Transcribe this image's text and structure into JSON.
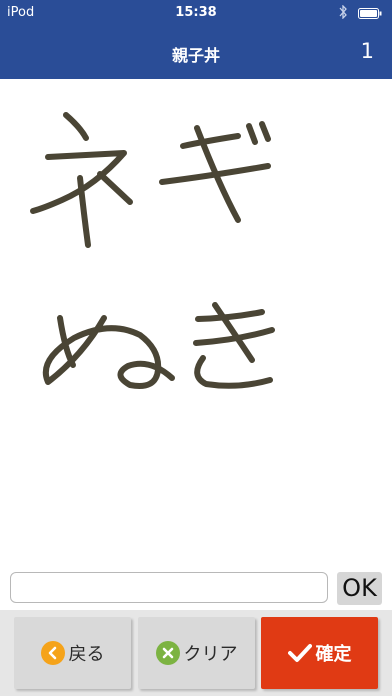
{
  "status_bar": {
    "carrier": "iPod",
    "time": "15:38"
  },
  "nav": {
    "title": "親子丼",
    "count": "1"
  },
  "handwriting": {
    "lines": [
      "ネギ",
      "ぬき"
    ],
    "ink_color": "#4a4535"
  },
  "input": {
    "value": "",
    "placeholder": ""
  },
  "ok_label": "OK",
  "toolbar": {
    "back_label": "戻る",
    "clear_label": "クリア",
    "confirm_label": "確定"
  },
  "colors": {
    "header": "#2a4d97",
    "confirm": "#e03a14",
    "back_icon": "#f5a31a",
    "clear_icon": "#7cb342"
  }
}
